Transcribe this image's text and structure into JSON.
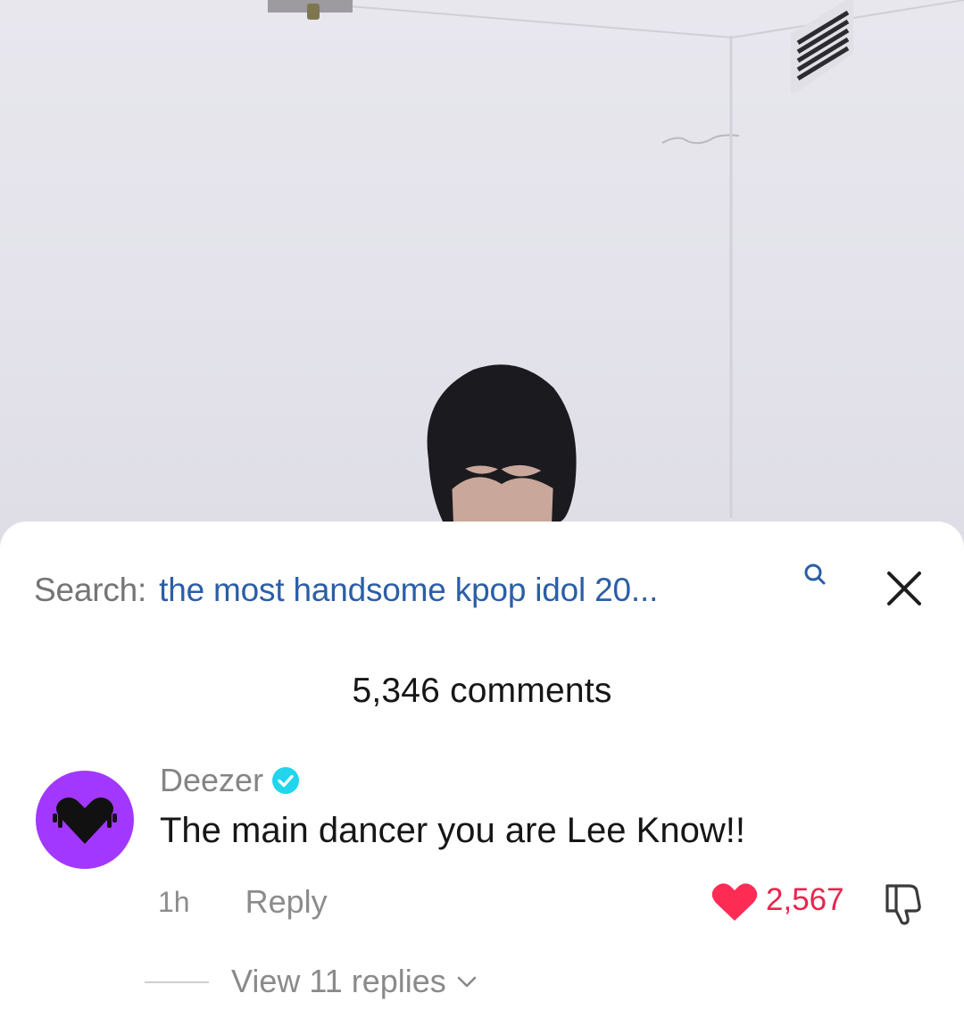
{
  "video": {
    "description_icon": "video-frame"
  },
  "search": {
    "prefix": "Search:",
    "query": "the most handsome kpop idol 20..."
  },
  "comments": {
    "count_label": "5,346 comments"
  },
  "comment": {
    "username": "Deezer",
    "text": "The main dancer you are Lee Know!!",
    "time": "1h",
    "reply_label": "Reply",
    "like_count": "2,567",
    "view_replies_label": "View 11 replies"
  },
  "colors": {
    "search_query": "#2b5ea7",
    "avatar_bg": "#a238ff",
    "like": "#fe2c55",
    "verified": "#20d5ec"
  }
}
